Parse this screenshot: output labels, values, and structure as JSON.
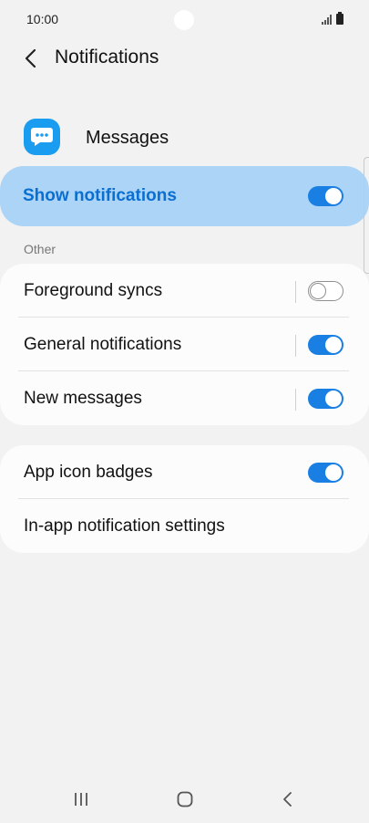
{
  "status_bar": {
    "time": "10:00"
  },
  "header": {
    "title": "Notifications",
    "back_icon": "chevron-left-icon"
  },
  "app": {
    "name": "Messages",
    "icon": "chat-bubble-icon",
    "icon_color": "#1a9df0"
  },
  "master_toggle": {
    "label": "Show notifications",
    "state": "on"
  },
  "section_other": {
    "header": "Other",
    "rows": [
      {
        "label": "Foreground syncs",
        "toggle": "off"
      },
      {
        "label": "General notifications",
        "toggle": "on"
      },
      {
        "label": "New messages",
        "toggle": "on"
      }
    ]
  },
  "section_badges": {
    "rows": [
      {
        "label": "App icon badges",
        "toggle": "on"
      },
      {
        "label": "In-app notification settings"
      }
    ]
  },
  "colors": {
    "accent": "#1a7fe2",
    "highlight": "#abd4f7",
    "background": "#f2f2f2"
  },
  "nav_bar": {
    "recents_icon": "recents-icon",
    "home_icon": "home-icon",
    "back_icon": "back-icon"
  }
}
